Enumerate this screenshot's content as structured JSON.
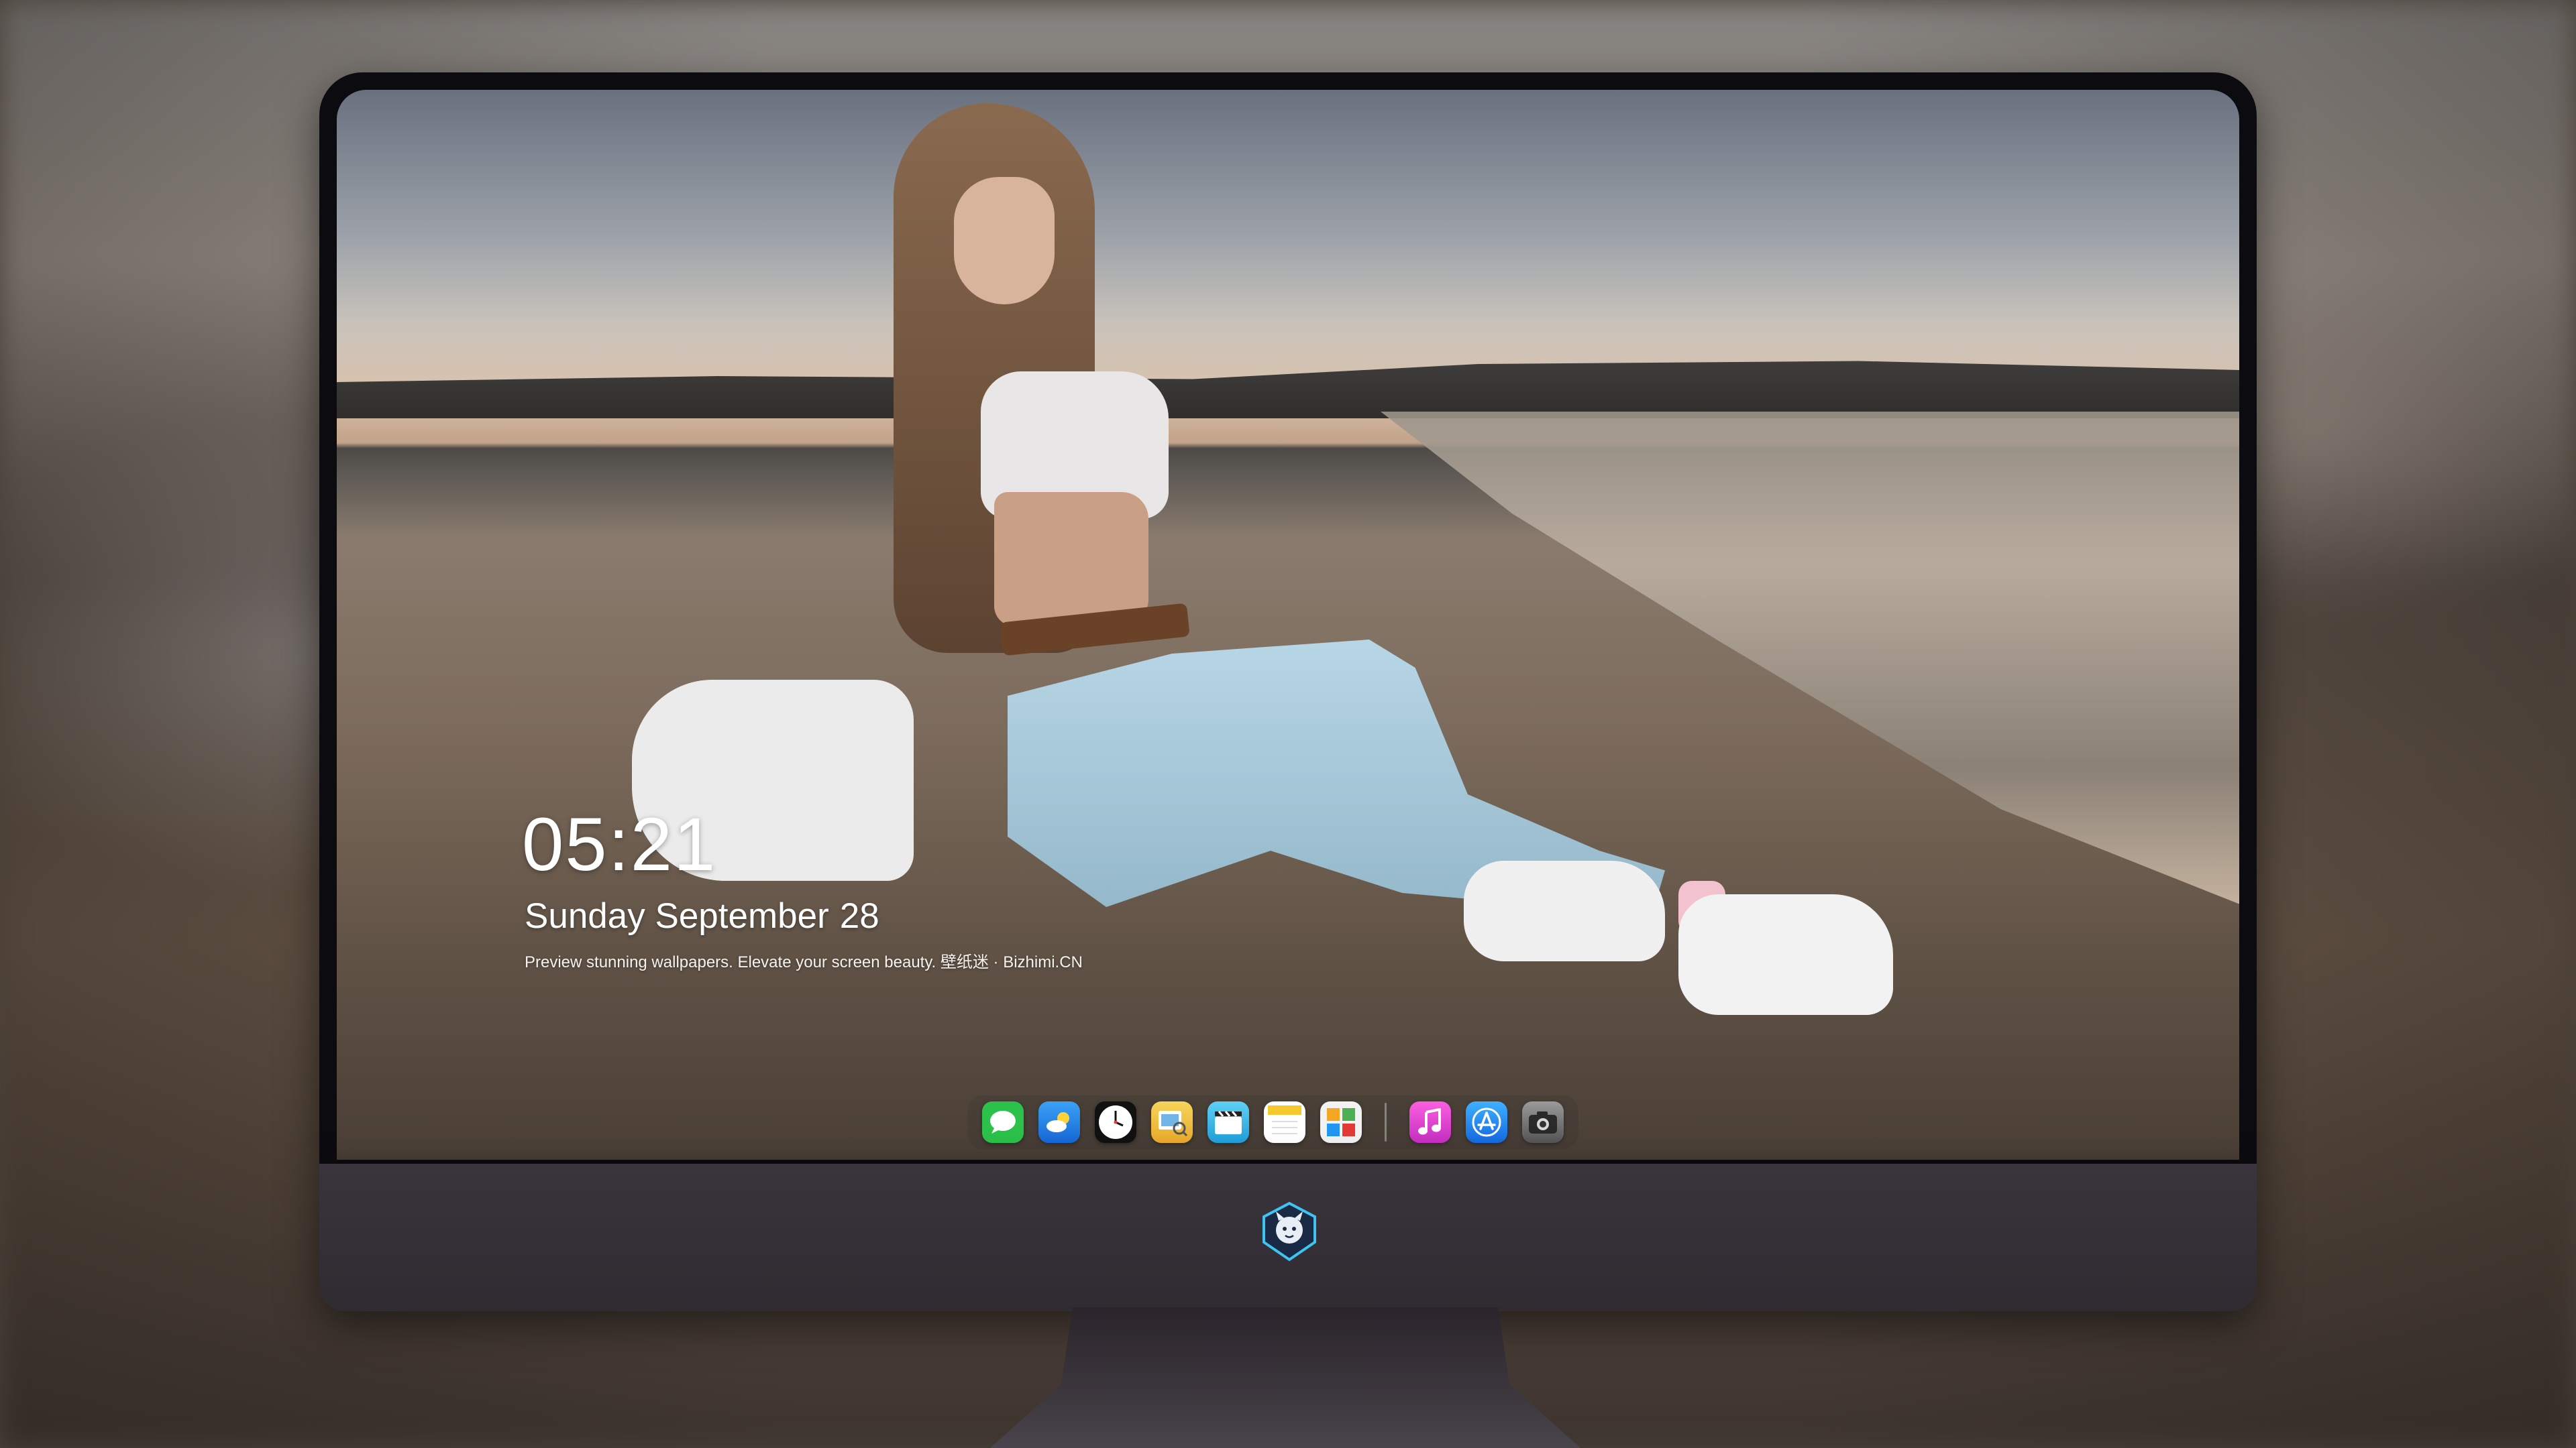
{
  "lock_screen": {
    "time": "05:21",
    "weekday_month": "Sunday September",
    "day": "28",
    "caption": "Preview stunning wallpapers. Elevate your screen beauty. 壁纸迷 · Bizhimi.CN"
  },
  "dock": {
    "apps": [
      {
        "name": "messages-icon",
        "color": "#2bc14a"
      },
      {
        "name": "weather-icon",
        "color": "#1e8ff0"
      },
      {
        "name": "clock-icon",
        "color": "#1a1a1a"
      },
      {
        "name": "preview-icon",
        "color": "#f3c13a"
      },
      {
        "name": "clips-icon",
        "color": "#38b7e8"
      },
      {
        "name": "notes-icon",
        "color": "#f5d33b"
      },
      {
        "name": "photo-grid-icon",
        "color": "#e8e8e8"
      },
      {
        "name": "music-icon",
        "color": "#f04ad0"
      },
      {
        "name": "app-store-icon",
        "color": "#1a8cf5"
      },
      {
        "name": "camera-icon",
        "color": "#6f6f6f"
      }
    ]
  },
  "colors": {
    "bezel": "#0c0c10",
    "chin": "#35303a",
    "text": "#ffffff"
  }
}
